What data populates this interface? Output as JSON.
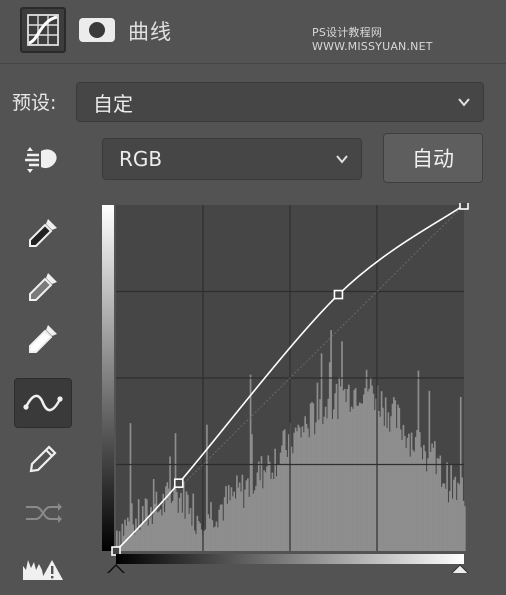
{
  "panel": {
    "title": "曲线",
    "watermark": "PS设计教程网 WWW.MISSYUAN.NET",
    "header_icons": [
      "curves-adjustment-icon",
      "layer-mask-icon"
    ]
  },
  "preset": {
    "label": "预设:",
    "value": "自定"
  },
  "channel": {
    "value": "RGB"
  },
  "auto_button": {
    "label": "自动"
  },
  "tools": [
    {
      "name": "on-image-adjustment-icon"
    },
    {
      "name": "black-point-eyedropper-icon"
    },
    {
      "name": "gray-point-eyedropper-icon"
    },
    {
      "name": "white-point-eyedropper-icon"
    },
    {
      "name": "curve-points-icon",
      "active": true
    },
    {
      "name": "pencil-draw-icon"
    },
    {
      "name": "smooth-curve-icon"
    },
    {
      "name": "clipping-warning-icon"
    }
  ],
  "curve": {
    "input_range": [
      0,
      255
    ],
    "output_range": [
      0,
      255
    ],
    "points": [
      [
        0,
        0
      ],
      [
        46,
        50
      ],
      [
        163,
        189
      ],
      [
        255,
        255
      ]
    ],
    "grid_divisions": 4
  },
  "colors": {
    "panel_bg": "#535353",
    "graph_bg": "#464646",
    "histogram": "#8e8e8e",
    "curve_line": "#ffffff"
  }
}
